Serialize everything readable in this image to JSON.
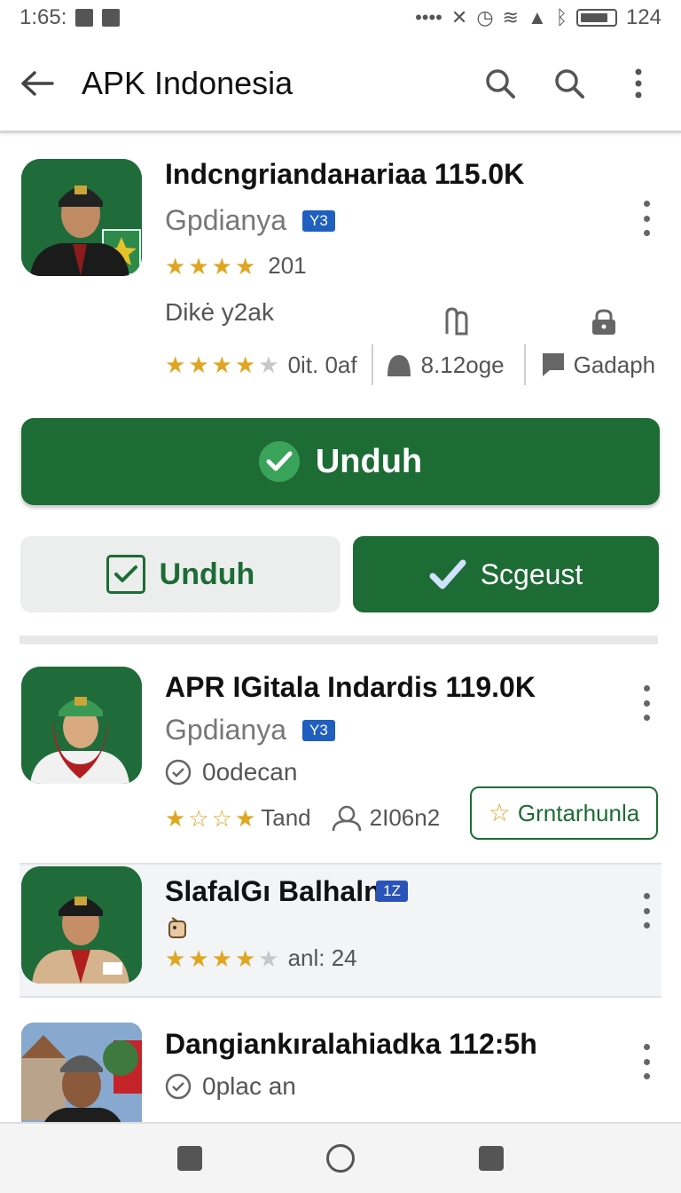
{
  "status_bar": {
    "time": "1:65:",
    "dots": "••••",
    "battery_level": "124"
  },
  "app_bar": {
    "title": "APK Indonesia"
  },
  "featured": {
    "title": "Indcngriandaнariaa 115.0K",
    "subtitle": "Gpdianya",
    "badge": "Y3",
    "rating_count": "201",
    "stars": 4,
    "detail_label": "Dikė y2ak",
    "detail_rating_text": "0it. 0af",
    "size_text": "8.12oge",
    "category_text": "Gadaph"
  },
  "buttons": {
    "primary_label": "Unduh",
    "secondary_label": "Unduh",
    "dark_label": "Scgeust"
  },
  "items": [
    {
      "title": "APR IGitala Indardis 119.0K",
      "subtitle": "Gpdianya",
      "badge": "Y3",
      "status": "0odecan",
      "rating_text": "Tand",
      "downloads": "2I06n2",
      "action_label": "Grntarhunla"
    },
    {
      "title": "SlafalGı Balhaln",
      "badge": "1Z",
      "rating_text": "anl: 24"
    },
    {
      "title": "Dangiankıralahiadka 112:5h",
      "status": "0plac an"
    }
  ],
  "colors": {
    "brand_green": "#1d6b35",
    "star_gold": "#e0a622",
    "badge_blue": "#1e5fc0"
  }
}
